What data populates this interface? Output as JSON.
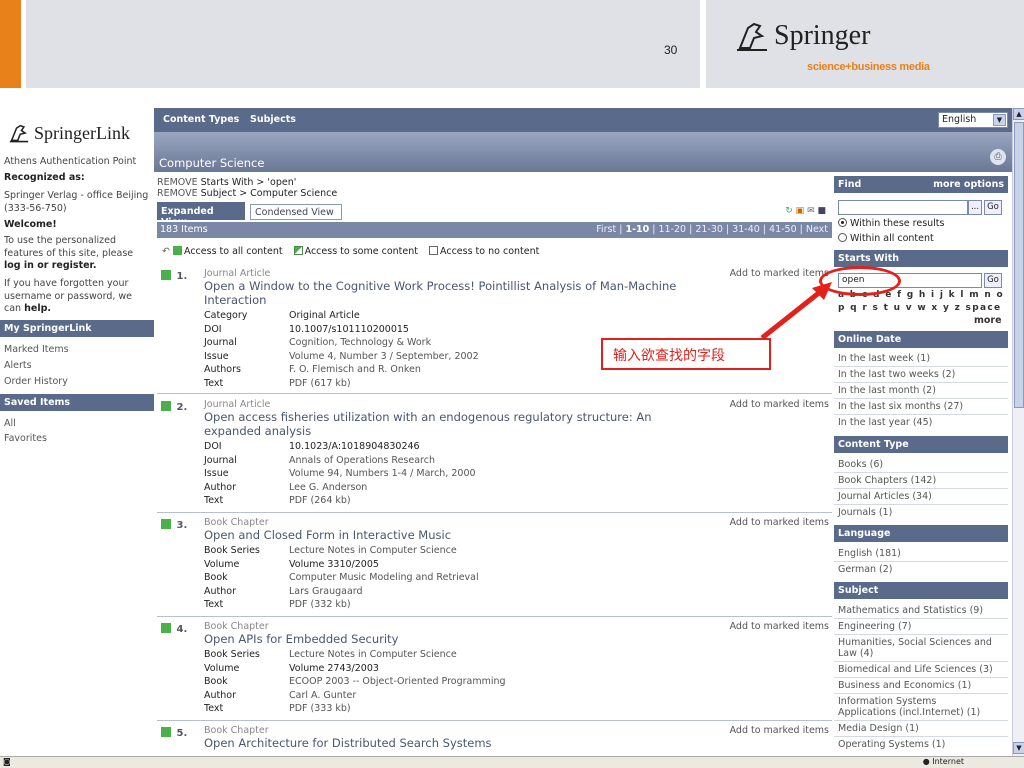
{
  "slide": {
    "page_number": "30",
    "brand": "Springer",
    "brand_sub": "science+business media"
  },
  "sidebar": {
    "logo": "SpringerLink",
    "auth_point": "Athens Authentication Point",
    "recognized_label": "Recognized as:",
    "recognized_value": "Springer Verlag - office Beijing (333-56-750)",
    "welcome": "Welcome!",
    "welcome_text_1": "To use the personalized features of this site, please",
    "login_link": "log in or register.",
    "forgot_text": "If you have forgotten your username or password, we can",
    "help_link": "help.",
    "my_springerlink": "My SpringerLink",
    "my_items": [
      "Marked Items",
      "Alerts",
      "Order History"
    ],
    "saved_items": "Saved Items",
    "saved_list": [
      "All",
      "Favorites"
    ]
  },
  "topnav": {
    "content_types": "Content Types",
    "subjects": "Subjects",
    "language": "English"
  },
  "page_title": "Computer Science",
  "filters": {
    "remove_1_label": "REMOVE",
    "remove_1": "Starts With > 'open'",
    "remove_2_label": "REMOVE",
    "remove_2": "Subject > Computer Science"
  },
  "views": {
    "expanded": "Expanded View",
    "condensed": "Condensed View"
  },
  "items_count": "183 Items",
  "pager": {
    "first": "First |",
    "current": "1-10",
    "rest": "| 11-20 | 21-30 | 31-40 | 41-50 | Next"
  },
  "access": {
    "all": "Access to all content",
    "some": "Access to some content",
    "none": "Access to no content"
  },
  "add_marked": "Add to marked items",
  "results": [
    {
      "num": "1.",
      "type": "Journal Article",
      "title": "Open a Window to the Cognitive Work Process! Pointillist Analysis of Man-Machine Interaction",
      "fields": [
        {
          "k": "Category",
          "v": "Original Article"
        },
        {
          "k": "DOI",
          "v": "10.1007/s101110200015"
        },
        {
          "k": "Journal",
          "v": "Cognition, Technology & Work"
        },
        {
          "k": "Issue",
          "v": "Volume 4, Number 3 / September, 2002"
        },
        {
          "k": "Authors",
          "v": "F. O. Flemisch and R. Onken"
        },
        {
          "k": "Text",
          "v": "PDF (617 kb)"
        }
      ]
    },
    {
      "num": "2.",
      "type": "Journal Article",
      "title": "Open access fisheries utilization with an endogenous regulatory structure: An expanded analysis",
      "fields": [
        {
          "k": "DOI",
          "v": "10.1023/A:1018904830246"
        },
        {
          "k": "Journal",
          "v": "Annals of Operations Research"
        },
        {
          "k": "Issue",
          "v": "Volume 94, Numbers 1-4 / March, 2000"
        },
        {
          "k": "Author",
          "v": "Lee G. Anderson"
        },
        {
          "k": "Text",
          "v": "PDF (264 kb)"
        }
      ]
    },
    {
      "num": "3.",
      "type": "Book Chapter",
      "title": "Open and Closed Form in Interactive Music",
      "fields": [
        {
          "k": "Book Series",
          "v": "Lecture Notes in Computer Science"
        },
        {
          "k": "Volume",
          "v": "Volume 3310/2005"
        },
        {
          "k": "Book",
          "v": "Computer Music Modeling and Retrieval"
        },
        {
          "k": "Author",
          "v": "Lars Graugaard"
        },
        {
          "k": "Text",
          "v": "PDF (332 kb)"
        }
      ]
    },
    {
      "num": "4.",
      "type": "Book Chapter",
      "title": "Open APIs for Embedded Security",
      "fields": [
        {
          "k": "Book Series",
          "v": "Lecture Notes in Computer Science"
        },
        {
          "k": "Volume",
          "v": "Volume 2743/2003"
        },
        {
          "k": "Book",
          "v": "ECOOP 2003 -- Object-Oriented Programming"
        },
        {
          "k": "Author",
          "v": "Carl A. Gunter"
        },
        {
          "k": "Text",
          "v": "PDF (333 kb)"
        }
      ]
    },
    {
      "num": "5.",
      "type": "Book Chapter",
      "title": "Open Architecture for Distributed Search Systems",
      "fields": []
    }
  ],
  "right": {
    "find": "Find",
    "more_options": "more options",
    "browse_btn": "...",
    "go_btn": "Go",
    "within_these": "Within these results",
    "within_all": "Within all content",
    "starts_with": "Starts With",
    "starts_value": "open",
    "sw_go": "Go",
    "alpha_1": "a b c d e f g h i j k l m n o",
    "alpha_2": "p q r s t u v w x y z space",
    "more": "more",
    "online_date": "Online Date",
    "dates": [
      "In the last week (1)",
      "In the last two weeks (2)",
      "In the last month (2)",
      "In the last six months (27)",
      "In the last year (45)"
    ],
    "content_type": "Content Type",
    "types": [
      "Books (6)",
      "Book Chapters (142)",
      "Journal Articles (34)",
      "Journals (1)"
    ],
    "language": "Language",
    "languages": [
      "English (181)",
      "German (2)"
    ],
    "subject": "Subject",
    "subjects": [
      "Mathematics and Statistics (9)",
      "Engineering (7)",
      "Humanities, Social Sciences and",
      "Law (4)",
      "Biomedical and Life Sciences (3)",
      "Business and Economics (1)",
      "Information Systems",
      "Applications (incl.Internet) (1)",
      "Media Design (1)",
      "Operating Systems (1)"
    ]
  },
  "annotation": {
    "text": "输入欲查找的字段",
    "color": "#e3211b"
  },
  "status": {
    "zone": "Internet"
  }
}
